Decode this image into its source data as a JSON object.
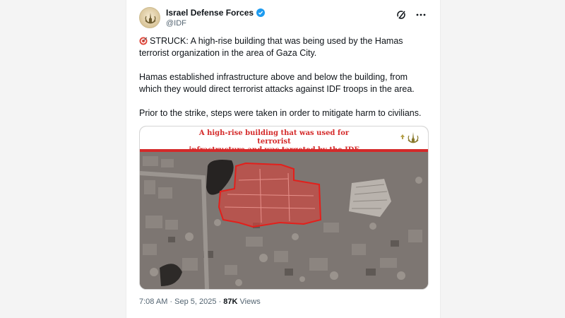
{
  "account": {
    "name": "Israel Defense Forces",
    "handle": "@IDF"
  },
  "tweet": {
    "para1": "STRUCK: A high-rise building that was being used by the Hamas terrorist organization in the area of Gaza City.",
    "para2": "Hamas established infrastructure above and below the building, from which they would direct terrorist attacks against IDF troops in the area.",
    "para3": "Prior to the strike, steps were taken in order to mitigate harm to civilians."
  },
  "media": {
    "banner_line1": "A high-rise building that was used for terrorist",
    "banner_line2": "infrastructure and was targeted by the IDF"
  },
  "meta": {
    "time": "7:08 AM",
    "date": "Sep 5, 2025",
    "separator": "·",
    "views_count": "87K",
    "views_label": "Views"
  },
  "icons": {
    "verified": "verified-badge-icon",
    "grok": "grok-icon",
    "more": "more-icon",
    "target": "direct-hit-icon"
  },
  "colors": {
    "banner_red": "#d42a2a",
    "verified_blue": "#1d9bf0"
  }
}
